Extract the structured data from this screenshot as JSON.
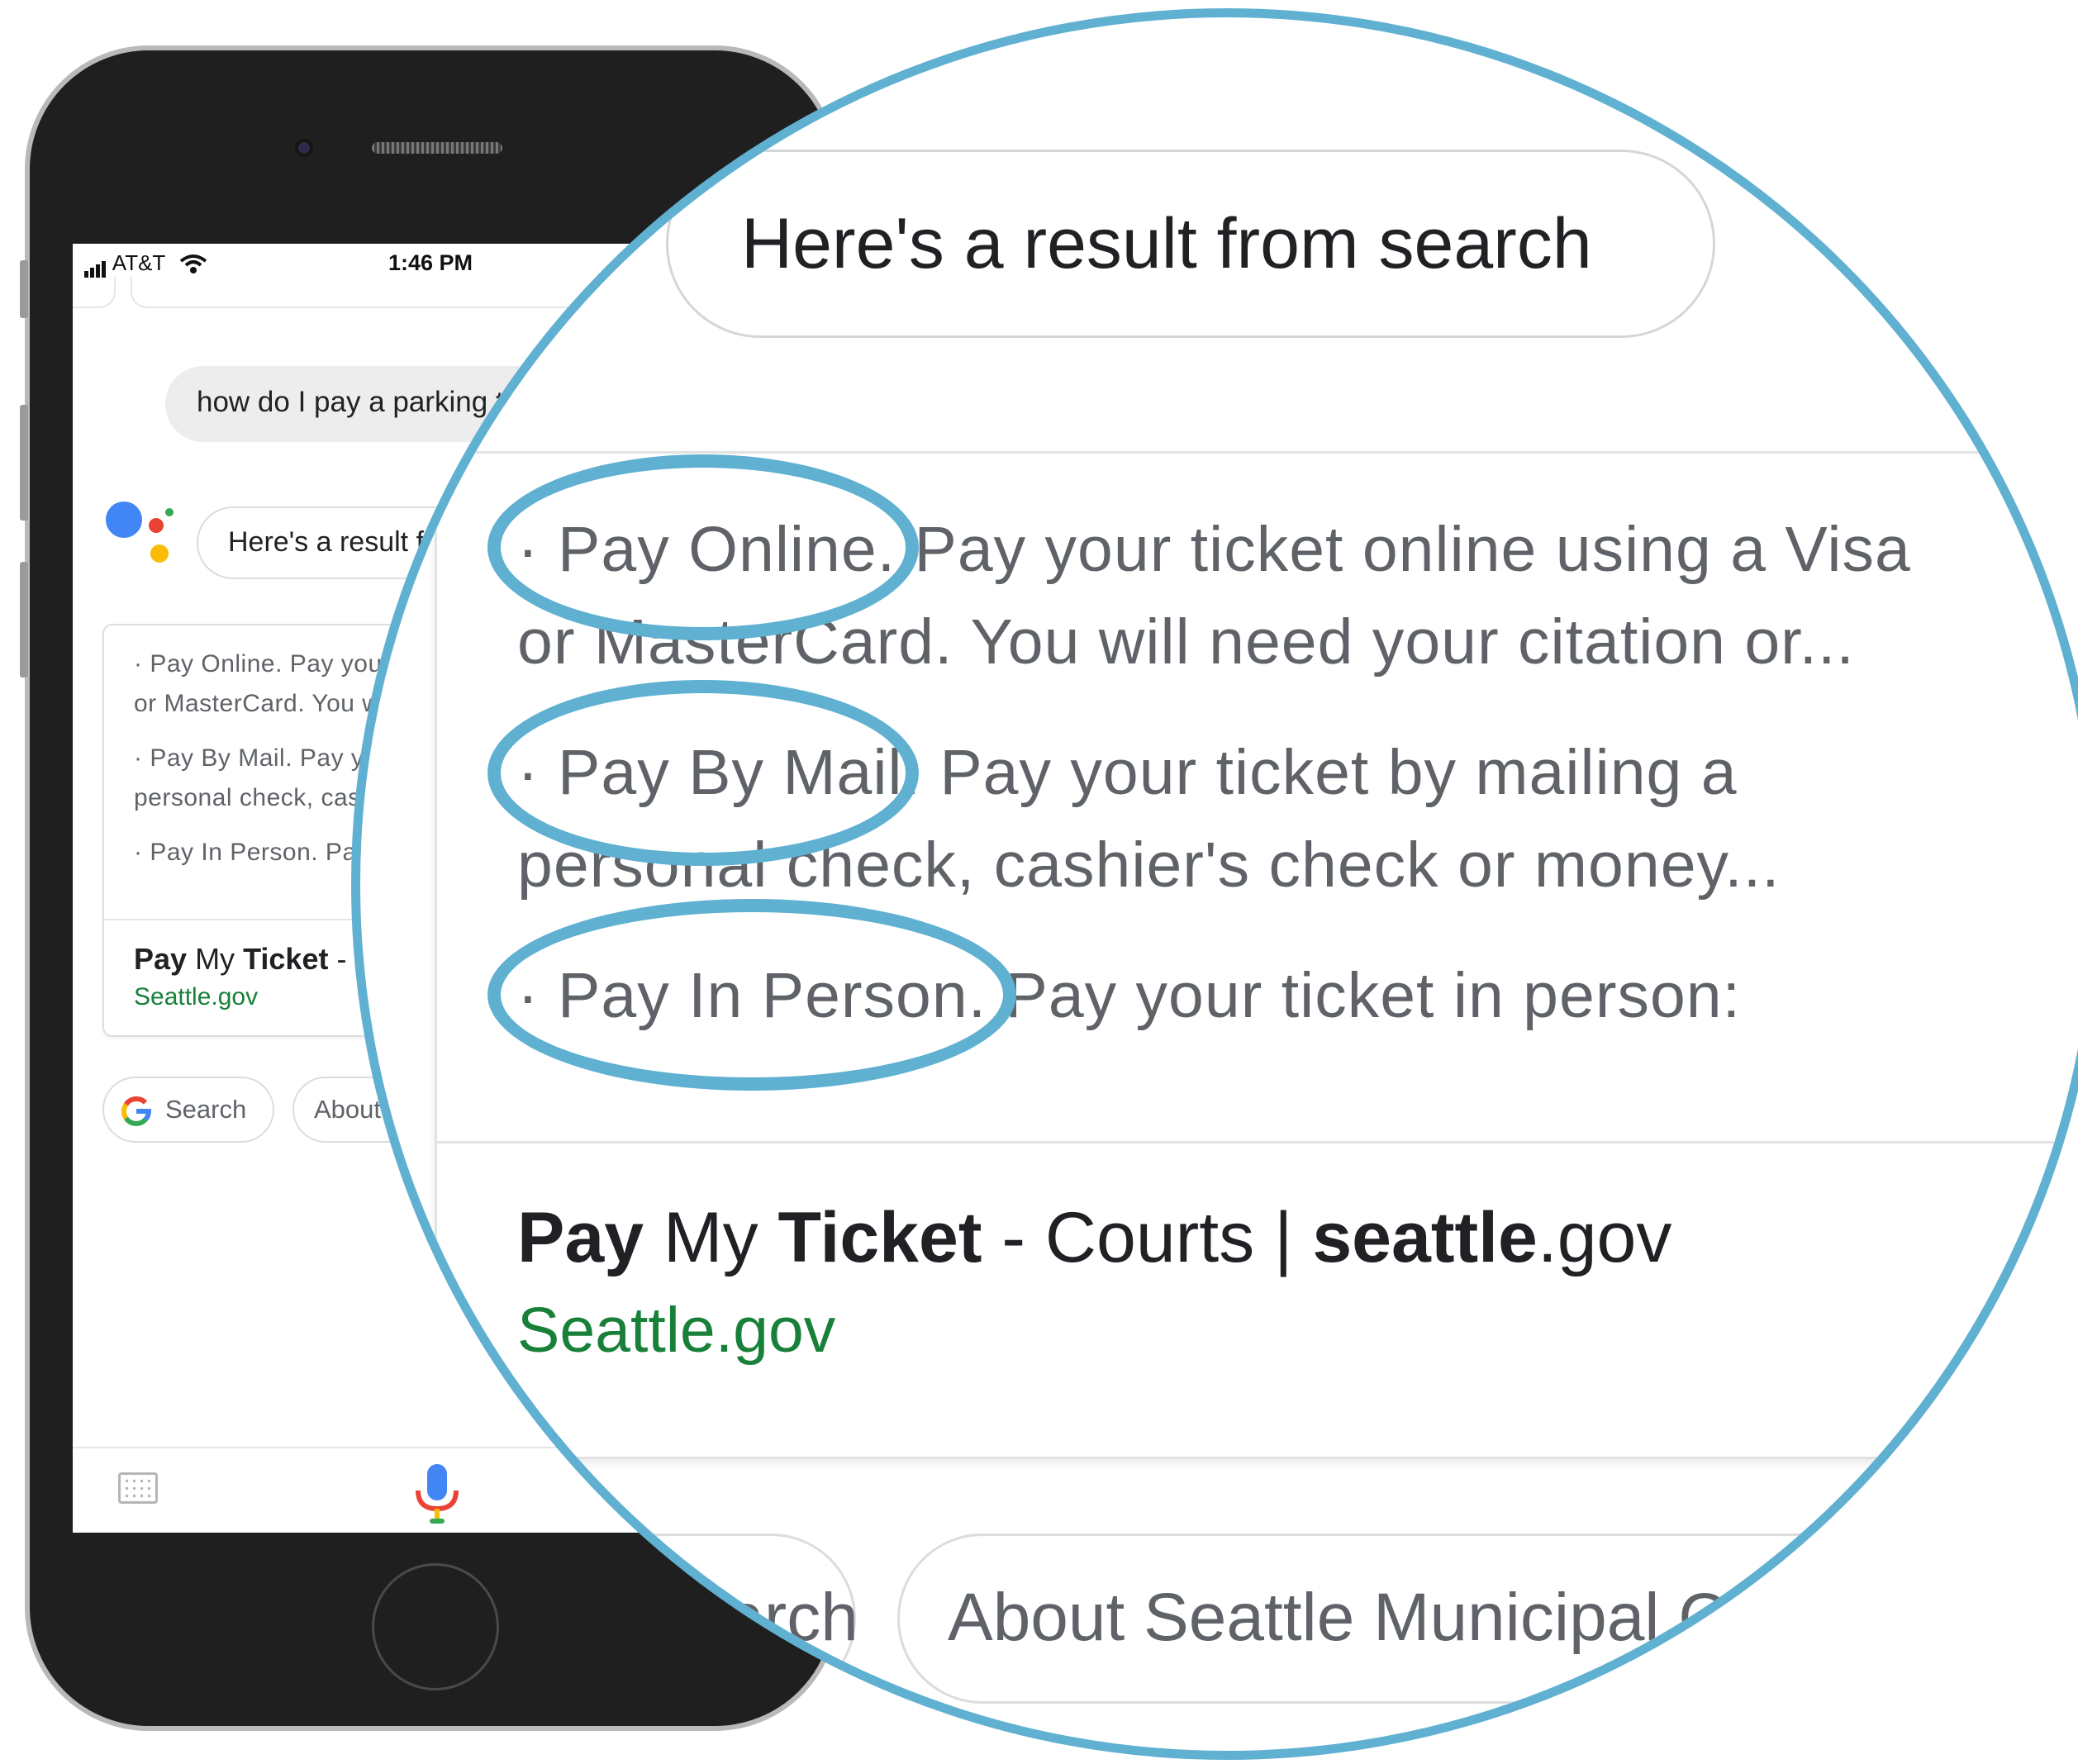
{
  "status_bar": {
    "carrier": "AT&T",
    "time": "1:46 PM"
  },
  "conversation": {
    "user_query": "how do I pay a parking ticket",
    "assistant_reply": "Here's a result from search"
  },
  "result_card": {
    "snippets": [
      {
        "line1": "· Pay Online. Pay your ticket online using a Visa",
        "line2": "or MasterCard. You will need your citation or..."
      },
      {
        "line1": "· Pay By Mail. Pay your ticket by mailing a",
        "line2": "personal check, cashier's check or money..."
      },
      {
        "line1": "· Pay In Person. Pay your ticket in person:",
        "line2": ""
      }
    ],
    "title": {
      "bold1": "Pay",
      "plain1": " My ",
      "bold2": "Ticket",
      "plain2": " - Courts | ",
      "bold3": "seattle",
      "plain3": ".gov"
    },
    "url": "Seattle.gov"
  },
  "suggestion_chips": [
    {
      "label": "Search",
      "icon": "google-g-icon"
    },
    {
      "label": "About Seattle Municipal Court"
    }
  ],
  "bottom_bar": {
    "keyboard_icon": "keyboard-icon",
    "mic_icon": "microphone-icon"
  },
  "highlight_color": "#5fb0d1",
  "assistant_logo_colors": [
    "#4285f4",
    "#ea4335",
    "#fbbc05",
    "#34a853"
  ]
}
